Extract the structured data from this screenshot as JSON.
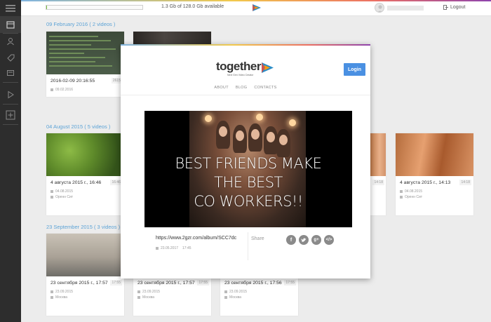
{
  "topbar": {
    "storage_text": "1.3 Gb of 128.0 Gb available",
    "storage_fraction": 0.01,
    "logout_label": "Logout",
    "accent_gradient": [
      "#7fb4e0",
      "#f2c94c",
      "#ec7063",
      "#8e44ad"
    ]
  },
  "sections": [
    {
      "header": "09 February 2016   ( 2 videos )",
      "cards": [
        {
          "title": "2016-02-09 20:16:55",
          "duration": "2615",
          "date": "09.02.2016",
          "location": ""
        },
        {
          "title": "",
          "duration": "",
          "date": "",
          "location": ""
        }
      ]
    },
    {
      "header": "04 August 2015   ( 5 videos )",
      "cards": [
        {
          "title": "4 августа 2015 г., 16:46",
          "duration": "16:46",
          "date": "04.08.2015",
          "location": "Оренн Сит"
        },
        {
          "title": "",
          "duration": "14:18",
          "date": "",
          "location": ""
        },
        {
          "title": "4 августа 2015 г., 14:13",
          "duration": "14:18",
          "date": "04.08.2015",
          "location": "Оренн Сит"
        }
      ]
    },
    {
      "header": "23 September 2015   ( 3 videos )",
      "cards": [
        {
          "title": "23 сентября 2015 г., 17:57",
          "duration": "17:55",
          "date": "23.09.2015",
          "location": "Москва"
        },
        {
          "title": "23 сентября 2015 г., 17:57",
          "duration": "17:55",
          "date": "23.09.2015",
          "location": "Москва"
        },
        {
          "title": "23 сентября 2015 г., 17:56",
          "duration": "17:55",
          "date": "23.09.2015",
          "location": "Москва"
        }
      ]
    }
  ],
  "modal": {
    "logo_text": "together",
    "slogan": "Next Gen Video Creator",
    "login_label": "Login",
    "nav": [
      "ABOUT",
      "BLOG",
      "CONTACTS"
    ],
    "video_caption": [
      "BEST FRIENDS MAKE",
      "THE BEST",
      "CO WORKERS!!"
    ],
    "url": "https://www.2gzr.com/album/SCC7dc",
    "date": "23.05.2017",
    "time": "17:45",
    "share_label": "Share",
    "share_icons": [
      "facebook-icon",
      "twitter-icon",
      "google-plus-icon",
      "embed-icon"
    ]
  }
}
